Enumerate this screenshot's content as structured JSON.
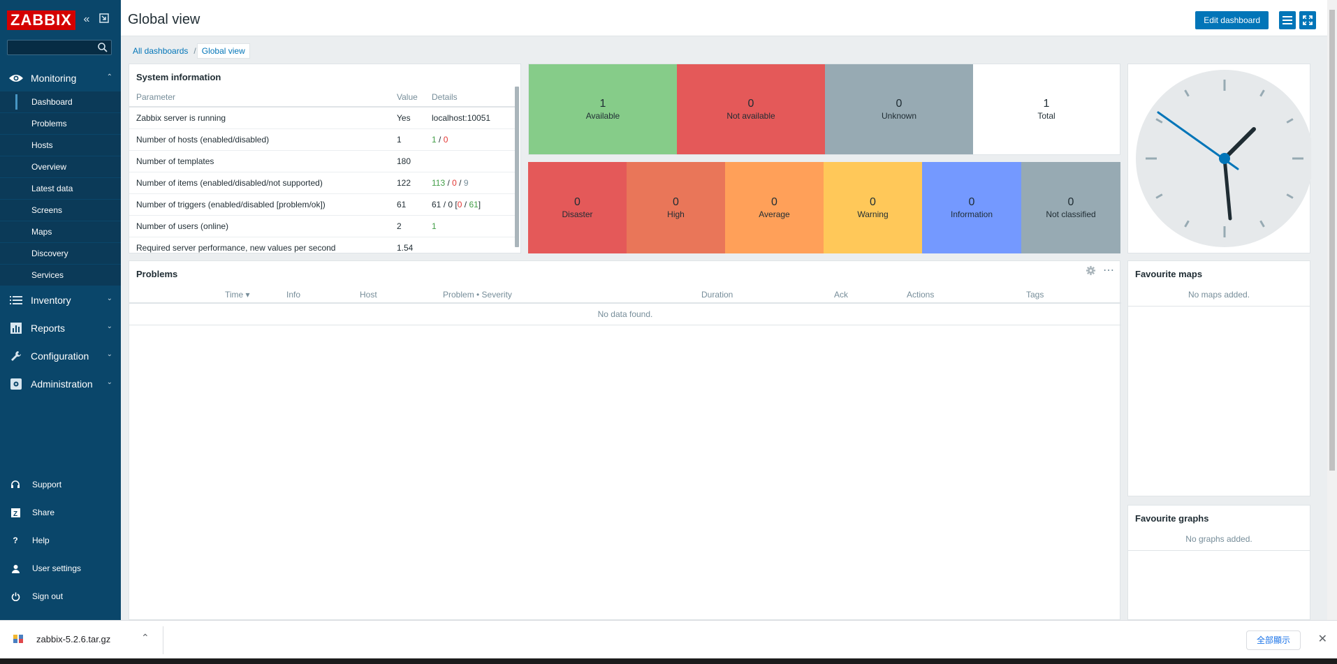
{
  "app": {
    "logo": "ZABBIX"
  },
  "sidebar": {
    "search_placeholder": "",
    "monitoring": {
      "label": "Monitoring",
      "items": [
        {
          "label": "Dashboard",
          "active": true
        },
        {
          "label": "Problems"
        },
        {
          "label": "Hosts"
        },
        {
          "label": "Overview"
        },
        {
          "label": "Latest data"
        },
        {
          "label": "Screens"
        },
        {
          "label": "Maps"
        },
        {
          "label": "Discovery"
        },
        {
          "label": "Services"
        }
      ]
    },
    "sections": [
      {
        "label": "Inventory"
      },
      {
        "label": "Reports"
      },
      {
        "label": "Configuration"
      },
      {
        "label": "Administration"
      }
    ],
    "bottom": [
      {
        "label": "Support"
      },
      {
        "label": "Share"
      },
      {
        "label": "Help"
      },
      {
        "label": "User settings"
      },
      {
        "label": "Sign out"
      }
    ]
  },
  "header": {
    "title": "Global view",
    "edit_label": "Edit dashboard"
  },
  "breadcrumb": {
    "root": "All dashboards",
    "sep": "/",
    "current": "Global view"
  },
  "system_info": {
    "title": "System information",
    "columns": [
      "Parameter",
      "Value",
      "Details"
    ],
    "rows": [
      {
        "param": "Zabbix server is running",
        "value": "Yes",
        "details": "localhost:10051"
      },
      {
        "param": "Number of hosts (enabled/disabled)",
        "value": "1",
        "d1": "1",
        "d2": "0"
      },
      {
        "param": "Number of templates",
        "value": "180"
      },
      {
        "param": "Number of items (enabled/disabled/not supported)",
        "value": "122",
        "d1": "113",
        "d2": "0",
        "d3": "9"
      },
      {
        "param": "Number of triggers (enabled/disabled [problem/ok])",
        "value": "61",
        "d1": "61",
        "d2": "0",
        "d3": "0",
        "d4": "61"
      },
      {
        "param": "Number of users (online)",
        "value": "2",
        "d1": "1"
      },
      {
        "param": "Required server performance, new values per second",
        "value": "1.54"
      }
    ]
  },
  "host_availability": [
    {
      "count": "1",
      "label": "Available",
      "color": "#86cc89"
    },
    {
      "count": "0",
      "label": "Not available",
      "color": "#e45959"
    },
    {
      "count": "0",
      "label": "Unknown",
      "color": "#97aab3"
    },
    {
      "count": "1",
      "label": "Total",
      "color": "#ffffff"
    }
  ],
  "severity": [
    {
      "count": "0",
      "label": "Disaster",
      "color": "#e45959"
    },
    {
      "count": "0",
      "label": "High",
      "color": "#e97659"
    },
    {
      "count": "0",
      "label": "Average",
      "color": "#ffa059"
    },
    {
      "count": "0",
      "label": "Warning",
      "color": "#ffc859"
    },
    {
      "count": "0",
      "label": "Information",
      "color": "#7499ff"
    },
    {
      "count": "0",
      "label": "Not classified",
      "color": "#97aab3"
    }
  ],
  "problems": {
    "title": "Problems",
    "columns": [
      "Time ▾",
      "Info",
      "Host",
      "Problem • Severity",
      "Duration",
      "Ack",
      "Actions",
      "Tags"
    ],
    "empty": "No data found."
  },
  "fav_maps": {
    "title": "Favourite maps",
    "empty": "No maps added."
  },
  "fav_graphs": {
    "title": "Favourite graphs",
    "empty": "No graphs added."
  },
  "downloads": {
    "file": "zabbix-5.2.6.tar.gz",
    "show_all": "全部顯示"
  }
}
